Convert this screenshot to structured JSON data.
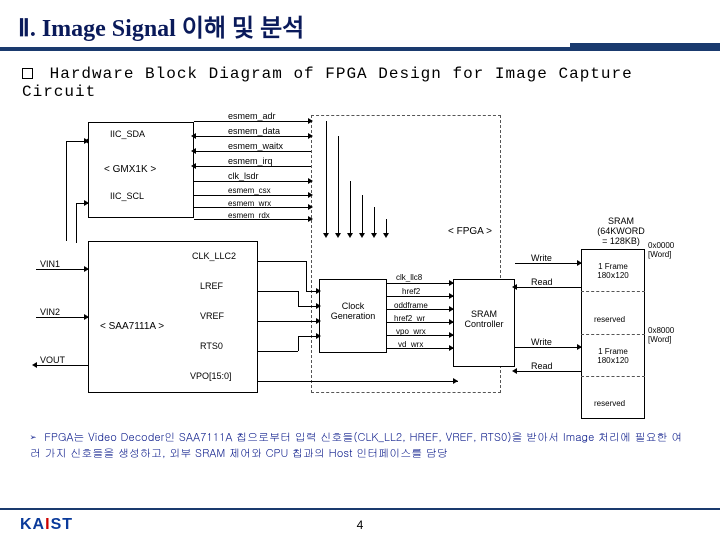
{
  "title": "Ⅱ. Image Signal 이해 및 분석",
  "subtitle": "Hardware Block Diagram of FPGA Design for Image Capture Circuit",
  "diagram": {
    "blocks": {
      "gmx1k": "< GMX1K >",
      "saa7111a": "< SAA7111A >",
      "clockgen": "Clock\nGeneration",
      "sramctrl": "SRAM\nController",
      "fpga": "< FPGA >",
      "sram_title": "SRAM\n(64KWORD\n= 128KB)"
    },
    "signals": {
      "iic_sda": "IIC_SDA",
      "iic_scl": "IIC_SCL",
      "vin1": "VIN1",
      "vin2": "VIN2",
      "vout": "VOUT",
      "clk_llc2": "CLK_LLC2",
      "lref": "LREF",
      "vref": "VREF",
      "rts0": "RTS0",
      "vpo": "VPO[15:0]",
      "esmem_adr": "esmem_adr",
      "esmem_data": "esmem_data",
      "esmem_waitx": "esmem_waitx",
      "esmem_irq": "esmem_irq",
      "clk_lsdr": "clk_lsdr",
      "esmem_csx": "esmem_csx",
      "esmem_wrx": "esmem_wrx",
      "esmem_rdx": "esmem_rdx",
      "clk_llc8": "clk_llc8",
      "href2": "href2",
      "oddframe": "oddframe",
      "href2_wr": "href2_wr",
      "vpo_wrx": "vpo_wrx",
      "vd_wrx": "vd_wrx",
      "write": "Write",
      "read": "Read"
    },
    "sram": {
      "addr0": "0x0000\n[Word]",
      "frame1": "1 Frame\n180ⅹ120",
      "reserved": "reserved",
      "addr8000": "0x8000\n[Word]",
      "frame2": "1 Frame\n180ⅹ120"
    }
  },
  "note": "FPGA는 Video Decoder인 SAA7111A 칩으로부터 입력 신호들(CLK_LL2, HREF, VREF, RTS0)을 받아서 Image 처리에 필요한 여러 가지 신호들을 생성하고, 외부 SRAM 제어와 CPU 칩과의 Host 인터페이스를 담당",
  "footer": {
    "logo": "KAIST",
    "page": "4"
  }
}
